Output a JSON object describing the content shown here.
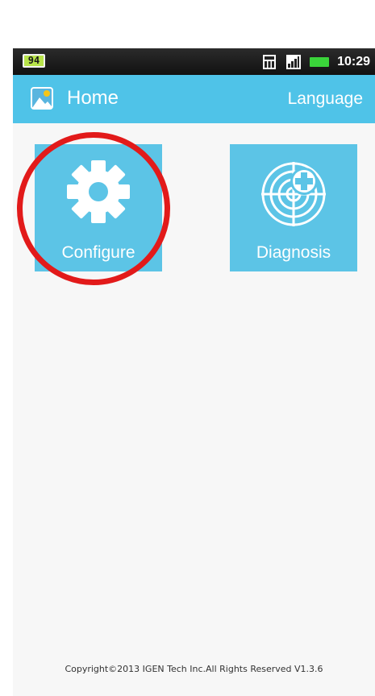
{
  "status_bar": {
    "battery_level": "94",
    "time": "10:29",
    "icons": [
      "sim-icon",
      "signal-icon",
      "battery-icon"
    ]
  },
  "app_bar": {
    "icon": "image-icon",
    "title": "Home",
    "language_label": "Language"
  },
  "tiles": [
    {
      "label": "Configure",
      "icon": "gear-icon"
    },
    {
      "label": "Diagnosis",
      "icon": "radar-cross-icon"
    }
  ],
  "annotation": {
    "shape": "circle",
    "target": "Configure",
    "color": "#e21a1a"
  },
  "footer": {
    "copyright": "Copyright©2013 IGEN Tech Inc.All Rights Reserved V1.3.6"
  },
  "colors": {
    "accent": "#4fc3e8",
    "tile": "#5cc4e6",
    "status_bar": "#1a1a1a",
    "highlight": "#e21a1a"
  }
}
